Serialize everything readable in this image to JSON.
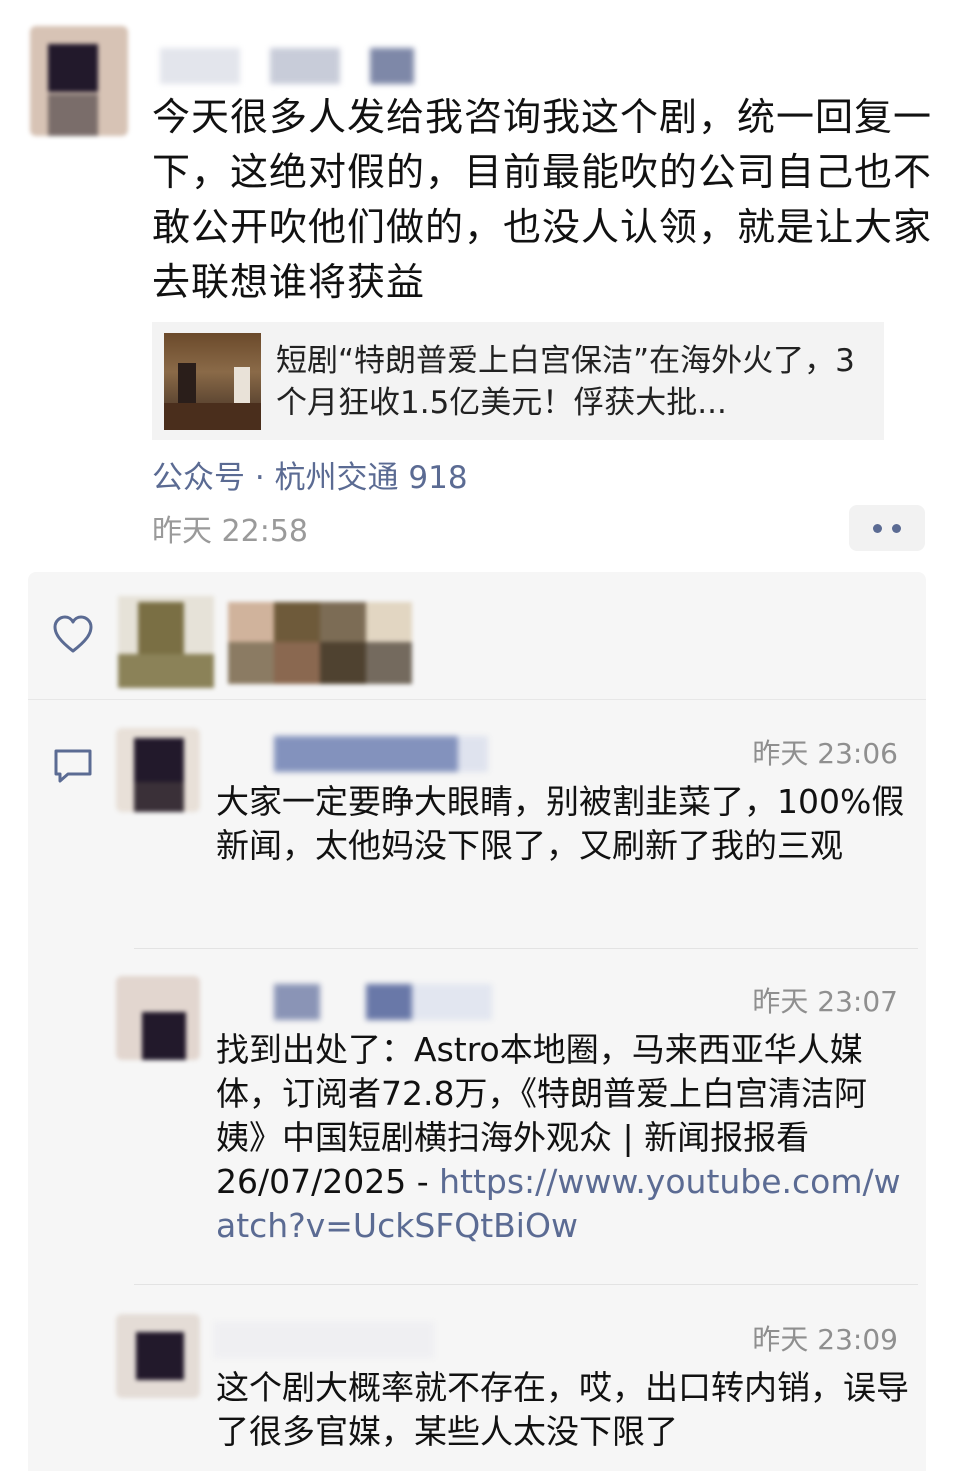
{
  "post": {
    "text": "今天很多人发给我咨询我这个剧，统一回复一下，这绝对假的，目前最能吹的公司自己也不敢公开吹他们做的，也没人认领，就是让大家去联想谁将获益",
    "link_card": {
      "title": "短剧“特朗普爱上白宫保洁”在海外火了，3个月狂收1.5亿美元！俘获大批..."
    },
    "source": "公众号 · 杭州交通 918",
    "time": "昨天 22:58"
  },
  "comments": [
    {
      "time": "昨天 23:06",
      "text": "大家一定要睁大眼睛，别被割韭菜了，100%假新闻，太他妈没下限了，又刷新了我的三观"
    },
    {
      "time": "昨天 23:07",
      "text": "找到出处了：Astro本地圈，马来西亚华人媒体，订阅者72.8万，《特朗普爱上白宫清洁阿姨》中国短剧横扫海外观众 | 新闻报报看 26/07/2025 - ",
      "link": "https://www.youtube.com/watch?v=UckSFQtBiOw"
    },
    {
      "time": "昨天 23:09",
      "text": "这个剧大概率就不存在，哎，出口转内销，误导了很多官媒，某些人太没下限了"
    }
  ],
  "colors": {
    "link_blue": "#5b6b93",
    "comment_bg": "#f6f6f6",
    "time_gray": "#9a9a9a"
  },
  "icons": [
    "heart-icon",
    "comment-icon",
    "more-icon"
  ]
}
